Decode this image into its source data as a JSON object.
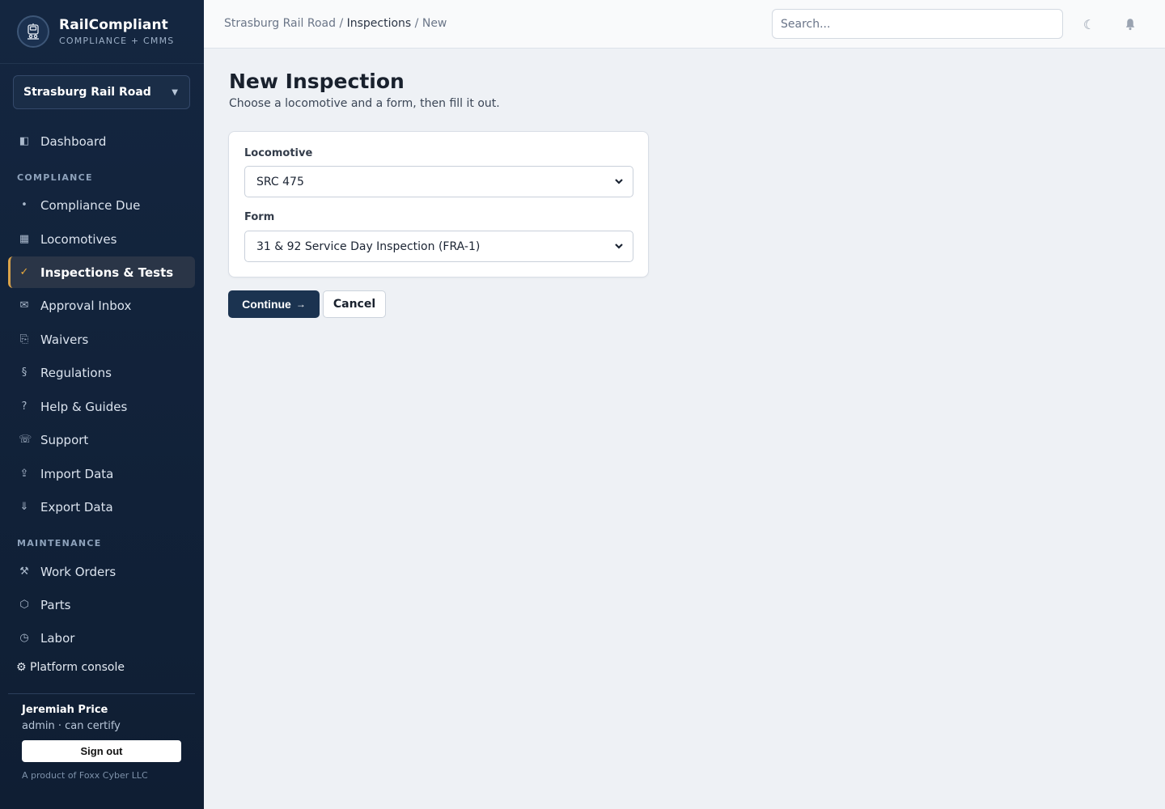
{
  "brand": {
    "name": "RailCompliant",
    "tagline": "COMPLIANCE + CMMS",
    "logo_icon": "locomotive-logo-icon"
  },
  "org_selector": {
    "value": "Strasburg Rail Road",
    "icon": "caret-down-icon"
  },
  "sidebar": {
    "top_items": [
      {
        "label": "Dashboard",
        "icon": "◧"
      }
    ],
    "compliance_label": "COMPLIANCE",
    "compliance_items": [
      {
        "label": "Compliance Due",
        "icon": "•"
      },
      {
        "label": "Locomotives",
        "icon": "▦"
      },
      {
        "label": "Inspections & Tests",
        "icon": "✓",
        "active": true
      },
      {
        "label": "Approval Inbox",
        "icon": "✉"
      },
      {
        "label": "Waivers",
        "icon": "⎘"
      },
      {
        "label": "Regulations",
        "icon": "§"
      },
      {
        "label": "Help & Guides",
        "icon": "?"
      },
      {
        "label": "Support",
        "icon": "☏"
      },
      {
        "label": "Import Data",
        "icon": "⇪"
      },
      {
        "label": "Export Data",
        "icon": "⇓"
      }
    ],
    "maintenance_label": "MAINTENANCE",
    "maintenance_items": [
      {
        "label": "Work Orders",
        "icon": "⚒"
      },
      {
        "label": "Parts",
        "icon": "⬡"
      },
      {
        "label": "Labor",
        "icon": "◷"
      }
    ],
    "platform_console": "⚙ Platform console",
    "accent_color": "#d9a24a"
  },
  "user": {
    "name": "Jeremiah Price",
    "role": "admin · can certify",
    "signout_label": "Sign out",
    "product_note": "A product of Foxx Cyber LLC"
  },
  "header": {
    "breadcrumb": {
      "root": "Strasburg Rail Road",
      "section": "Inspections",
      "current": "New",
      "sep": "/"
    },
    "search_placeholder": "Search...",
    "theme_icon": "☾",
    "bell_icon": "🔔"
  },
  "main": {
    "title": "New Inspection",
    "subtitle": "Choose a locomotive and a form, then fill it out.",
    "locomotive_label": "Locomotive",
    "locomotive_value": "SRC 475",
    "form_label": "Form",
    "form_value": "31 & 92 Service Day Inspection (FRA-1)",
    "continue_label": "Continue",
    "continue_arrow": "→",
    "cancel_label": "Cancel",
    "primary_color": "#1b3350"
  }
}
